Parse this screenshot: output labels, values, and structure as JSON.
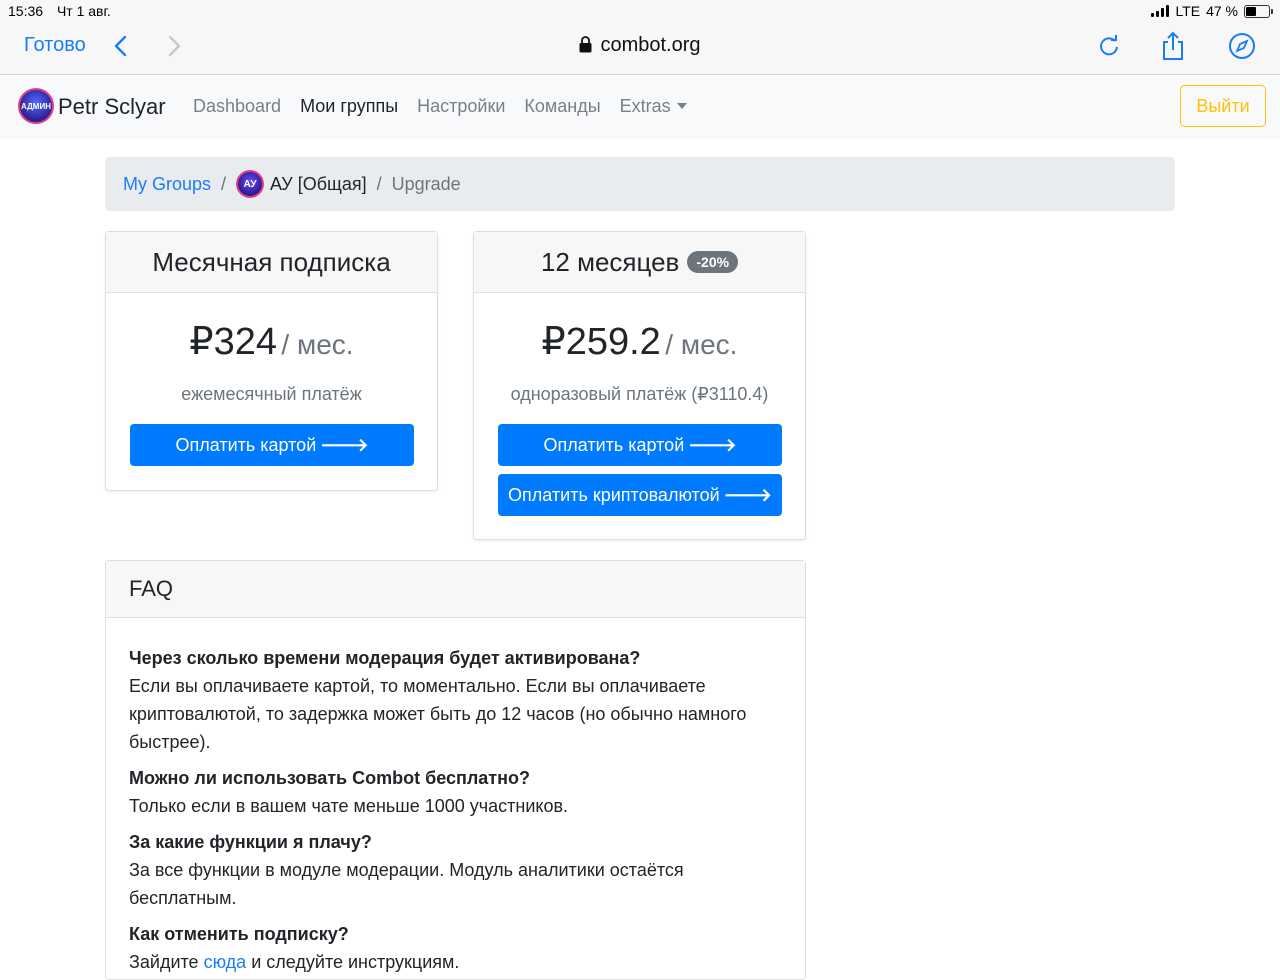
{
  "status_bar": {
    "time": "15:36",
    "date": "Чт 1 авг.",
    "network": "LTE",
    "battery": "47 %"
  },
  "safari": {
    "done_label": "Готово",
    "url": "combot.org"
  },
  "navbar": {
    "brand_name": "Petr Sclyar",
    "avatar_text": "АДМИН",
    "links": [
      "Dashboard",
      "Мои группы",
      "Настройки",
      "Команды",
      "Extras"
    ],
    "logout_label": "Выйти"
  },
  "breadcrumb": {
    "items": [
      "My Groups",
      "АУ [Общая]",
      "Upgrade"
    ],
    "group_avatar_text": "АУ"
  },
  "plans": [
    {
      "title": "Месячная подписка",
      "price": "₽324",
      "period": "/ мес.",
      "note": "ежемесячный платёж",
      "buttons": [
        "Оплатить картой"
      ]
    },
    {
      "title": "12 месяцев",
      "badge": "-20%",
      "price": "₽259.2",
      "period": "/ мес.",
      "note": "одноразовый платёж (₽3110.4)",
      "buttons": [
        "Оплатить картой",
        "Оплатить криптовалютой"
      ]
    }
  ],
  "faq": {
    "title": "FAQ",
    "items": [
      {
        "q": "Через сколько времени модерация будет активирована?",
        "a": "Если вы оплачиваете картой, то моментально. Если вы оплачиваете криптовалютой, то задержка может быть до 12 часов (но обычно намного быстрее)."
      },
      {
        "q": "Можно ли использовать Combot бесплатно?",
        "a": "Только если в вашем чате меньше 1000 участников."
      },
      {
        "q": "За какие функции я плачу?",
        "a": "За все функции в модуле модерации. Модуль аналитики остаётся бесплатным."
      },
      {
        "q": "Как отменить подписку?",
        "a_before": "Зайдите",
        "a_link": "сюда",
        "a_after": "и следуйте инструкциям."
      }
    ]
  },
  "colors": {
    "primary": "#007bff",
    "link": "#1a7df5",
    "warning": "#ffc107",
    "muted": "#6c757d"
  }
}
